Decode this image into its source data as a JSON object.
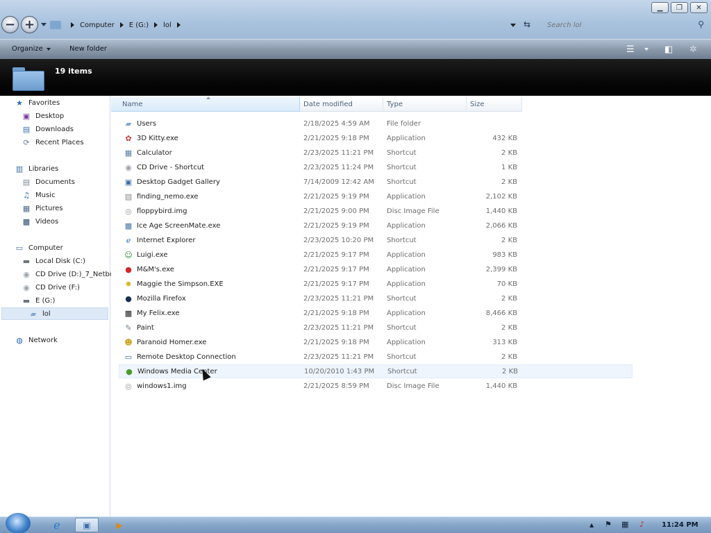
{
  "window": {
    "minimize_glyph": "▁",
    "maximize_glyph": "❐",
    "close_glyph": "✕"
  },
  "address": {
    "back_glyph": "−",
    "forward_glyph": "+",
    "crumbs": [
      "Computer",
      "E (G:)",
      "lol"
    ],
    "refresh_glyph": "⇆",
    "search_placeholder": "Search lol",
    "search_glyph": "⚲"
  },
  "toolbar": {
    "organize_label": "Organize",
    "new_folder_label": "New folder",
    "views_glyph": "☰",
    "preview_glyph": "◧",
    "help_glyph": "✲"
  },
  "details": {
    "count_label": "19 items"
  },
  "nav": {
    "favorites": {
      "label": "Favorites",
      "icon": "★"
    },
    "favorites_items": [
      {
        "label": "Desktop",
        "icon": "▣"
      },
      {
        "label": "Downloads",
        "icon": "▤"
      },
      {
        "label": "Recent Places",
        "icon": "⟳"
      }
    ],
    "libraries": {
      "label": "Libraries",
      "icon": "▥"
    },
    "libraries_items": [
      {
        "label": "Documents",
        "icon": "▤"
      },
      {
        "label": "Music",
        "icon": "♫"
      },
      {
        "label": "Pictures",
        "icon": "▦"
      },
      {
        "label": "Videos",
        "icon": "▩"
      }
    ],
    "computer": {
      "label": "Computer",
      "icon": "▭"
    },
    "computer_items": [
      {
        "label": "Local Disk (C:)",
        "icon": "▬"
      },
      {
        "label": "CD Drive (D:)_7_Netbo",
        "icon": "◉"
      },
      {
        "label": "CD Drive (F:)",
        "icon": "◉"
      },
      {
        "label": "E (G:)",
        "icon": "▬"
      },
      {
        "label": "lol",
        "icon": "▰"
      }
    ],
    "network": {
      "label": "Network",
      "icon": "◍"
    }
  },
  "columns": {
    "name": "Name",
    "date": "Date modified",
    "type": "Type",
    "size": "Size"
  },
  "files": [
    {
      "name": "Users",
      "date": "2/18/2025 4:59 AM",
      "type": "File folder",
      "size": "",
      "icon": "▰",
      "color": "#7fa6cf"
    },
    {
      "name": "3D Kitty.exe",
      "date": "2/21/2025 9:18 PM",
      "type": "Application",
      "size": "432 KB",
      "icon": "✿",
      "color": "#c43c3c"
    },
    {
      "name": "Calculator",
      "date": "2/23/2025 11:21 PM",
      "type": "Shortcut",
      "size": "2 KB",
      "icon": "▦",
      "color": "#5b7fa8"
    },
    {
      "name": "CD Drive - Shortcut",
      "date": "2/23/2025 11:24 PM",
      "type": "Shortcut",
      "size": "1 KB",
      "icon": "◉",
      "color": "#9aa3ad"
    },
    {
      "name": "Desktop Gadget Gallery",
      "date": "7/14/2009 12:42 AM",
      "type": "Shortcut",
      "size": "2 KB",
      "icon": "▣",
      "color": "#3e6fa6"
    },
    {
      "name": "finding_nemo.exe",
      "date": "2/21/2025 9:19 PM",
      "type": "Application",
      "size": "2,102 KB",
      "icon": "▧",
      "color": "#8a8a8a"
    },
    {
      "name": "floppybird.img",
      "date": "2/21/2025 9:00 PM",
      "type": "Disc Image File",
      "size": "1,440 KB",
      "icon": "◎",
      "color": "#8f959b"
    },
    {
      "name": "Ice Age ScreenMate.exe",
      "date": "2/21/2025 9:19 PM",
      "type": "Application",
      "size": "2,066 KB",
      "icon": "▩",
      "color": "#4e79a8"
    },
    {
      "name": "Internet Explorer",
      "date": "2/23/2025 10:20 PM",
      "type": "Shortcut",
      "size": "2 KB",
      "icon": "ℯ",
      "color": "#2a78c8"
    },
    {
      "name": "Luigi.exe",
      "date": "2/21/2025 9:17 PM",
      "type": "Application",
      "size": "983 KB",
      "icon": "☺",
      "color": "#2b8a3e"
    },
    {
      "name": "M&M's.exe",
      "date": "2/21/2025 9:17 PM",
      "type": "Application",
      "size": "2,399 KB",
      "icon": "●",
      "color": "#d1262a"
    },
    {
      "name": "Maggie the Simpson.EXE",
      "date": "2/21/2025 9:17 PM",
      "type": "Application",
      "size": "70 KB",
      "icon": "✸",
      "color": "#d8b21a"
    },
    {
      "name": "Mozilla Firefox",
      "date": "2/23/2025 11:21 PM",
      "type": "Shortcut",
      "size": "2 KB",
      "icon": "●",
      "color": "#1b2d52"
    },
    {
      "name": "My Felix.exe",
      "date": "2/21/2025 9:18 PM",
      "type": "Application",
      "size": "8,466 KB",
      "icon": "▩",
      "color": "#222222"
    },
    {
      "name": "Paint",
      "date": "2/23/2025 11:21 PM",
      "type": "Shortcut",
      "size": "2 KB",
      "icon": "✎",
      "color": "#6a7f96"
    },
    {
      "name": "Paranoid Homer.exe",
      "date": "2/21/2025 9:18 PM",
      "type": "Application",
      "size": "313 KB",
      "icon": "☻",
      "color": "#c9a31a"
    },
    {
      "name": "Remote Desktop Connection",
      "date": "2/23/2025 11:21 PM",
      "type": "Shortcut",
      "size": "2 KB",
      "icon": "▭",
      "color": "#3a64a0"
    },
    {
      "name": "Windows Media Center",
      "date": "10/20/2010 1:43 PM",
      "type": "Shortcut",
      "size": "2 KB",
      "icon": "●",
      "color": "#4c9a2a"
    },
    {
      "name": "windows1.img",
      "date": "2/21/2025 8:59 PM",
      "type": "Disc Image File",
      "size": "1,440 KB",
      "icon": "◎",
      "color": "#8f959b"
    }
  ],
  "taskbar": {
    "start_glyph": "",
    "ie_glyph": "ℯ",
    "explorer_glyph": "▣",
    "media_glyph": "▶",
    "tray_up_glyph": "▲",
    "flag_glyph": "⚑",
    "network_glyph": "▦",
    "volume_glyph": "♪",
    "clock": "11:24 PM"
  }
}
